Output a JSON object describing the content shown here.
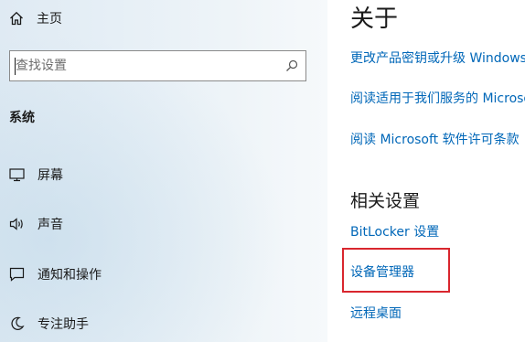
{
  "nav": {
    "home_label": "主页",
    "search": {
      "placeholder": "查找设置"
    },
    "section_title": "系统",
    "items": [
      {
        "label": "屏幕",
        "icon": "monitor-icon"
      },
      {
        "label": "声音",
        "icon": "speaker-icon"
      },
      {
        "label": "通知和操作",
        "icon": "notification-icon"
      },
      {
        "label": "专注助手",
        "icon": "focus-assist-icon"
      }
    ]
  },
  "content": {
    "title": "关于",
    "links": [
      "更改产品密钥或升级 Windows",
      "阅读适用于我们服务的 Microsoft 服务协议",
      "阅读 Microsoft 软件许可条款"
    ],
    "related_title": "相关设置",
    "related_links": [
      "BitLocker 设置",
      "设备管理器",
      "远程桌面"
    ],
    "highlight_color": "#d9262e"
  },
  "colors": {
    "link": "#0067b8",
    "text": "#1a1a1a"
  }
}
